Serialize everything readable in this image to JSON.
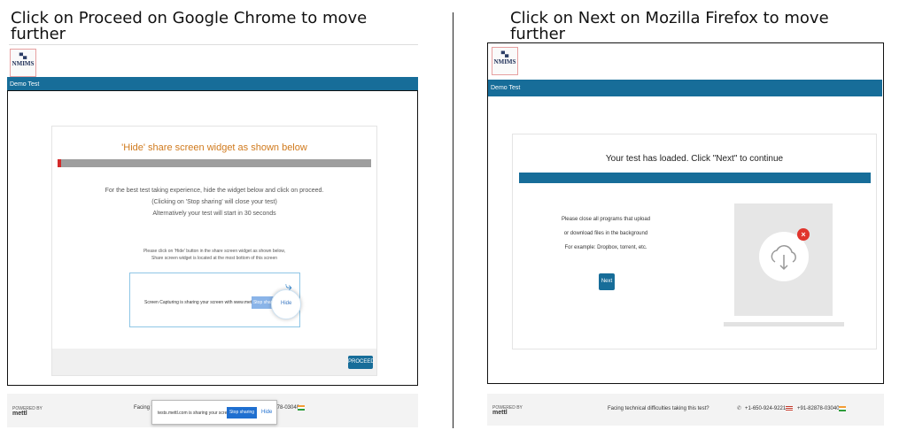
{
  "left": {
    "caption": "Click on Proceed on Google Chrome to move further",
    "logo_text": "NMIMS",
    "header_label": "Demo Test",
    "card_title": "'Hide' share screen widget as shown below",
    "instructions": [
      "For the best test taking experience, hide the widget below and click on proceed.",
      "(Clicking on 'Stop sharing' will close your test)",
      "Alternatively your test will start in 30 seconds"
    ],
    "small_instructions": [
      "Please click on 'Hide' button in the share screen widget as shown below,",
      "Share screen widget is located at the most bottom of this screen"
    ],
    "widget": {
      "message": "Screen Capturing is sharing your screen with www.mettl.com",
      "stop_label": "Stop sharing",
      "hide_label": "Hide"
    },
    "proceed_label": "PROCEED",
    "footer": {
      "brand": "mettl",
      "brand_small": "POWERED BY",
      "facing_text": "Facing tec",
      "phone_partial": "2878-03040"
    },
    "share_overlay": {
      "text": "tests.mettl.com is sharing your screen",
      "stop_label": "Stop sharing",
      "hide_label": "Hide"
    }
  },
  "right": {
    "caption": "Click on Next on Mozilla Firefox to move further",
    "logo_text": "NMIMS",
    "header_label": "Demo Test",
    "card_title": "Your test has loaded. Click \"Next\" to continue",
    "instructions": [
      "Please close all programs that upload",
      "or download files in the background",
      "For example: Dropbox, torrent, etc."
    ],
    "next_label": "Next",
    "footer": {
      "brand": "mettl",
      "brand_small": "POWERED BY",
      "facing_text": "Facing technical difficulties taking this test?",
      "phone_us": "+1-650-924-9221",
      "phone_in": "+91-82878-03040"
    }
  },
  "colors": {
    "brand_blue": "#176d99",
    "orange": "#d07a1d",
    "danger_red": "#e0342c"
  },
  "icons": [
    "cloud-download-icon",
    "close-badge-icon",
    "phone-icon",
    "us-flag-icon",
    "india-flag-icon",
    "hide-arrow-icon"
  ]
}
